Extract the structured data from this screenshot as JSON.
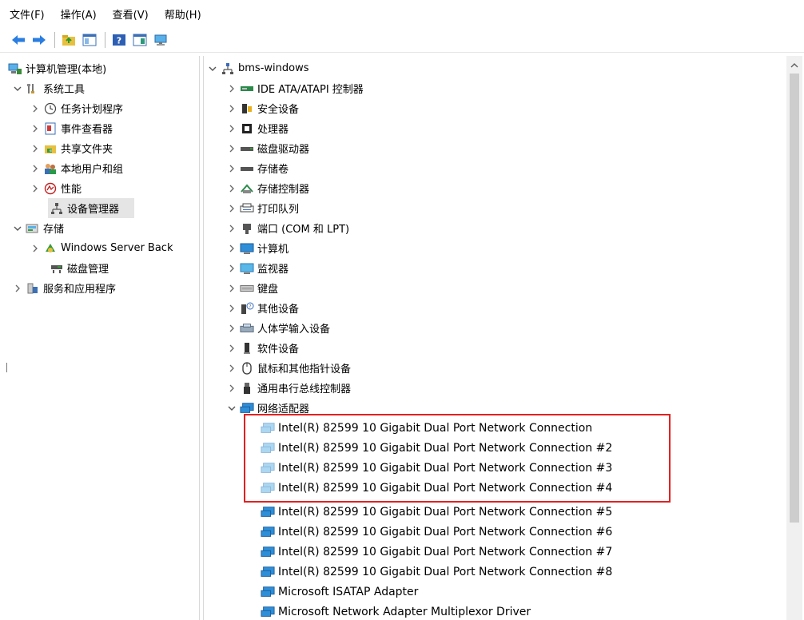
{
  "menu": {
    "file": "文件(F)",
    "action": "操作(A)",
    "view": "查看(V)",
    "help": "帮助(H)"
  },
  "left_tree": {
    "root": "计算机管理(本地)",
    "system_tools": "系统工具",
    "task_scheduler": "任务计划程序",
    "event_viewer": "事件查看器",
    "shared_folders": "共享文件夹",
    "local_users": "本地用户和组",
    "performance": "性能",
    "device_manager": "设备管理器",
    "storage": "存储",
    "windows_server_backup": "Windows Server Back",
    "disk_management": "磁盘管理",
    "services_apps": "服务和应用程序"
  },
  "device_tree": {
    "computer_name": "bms-windows",
    "categories": [
      "IDE ATA/ATAPI 控制器",
      "安全设备",
      "处理器",
      "磁盘驱动器",
      "存储卷",
      "存储控制器",
      "打印队列",
      "端口 (COM 和 LPT)",
      "计算机",
      "监视器",
      "键盘",
      "其他设备",
      "人体学输入设备",
      "软件设备",
      "鼠标和其他指针设备",
      "通用串行总线控制器",
      "网络适配器"
    ],
    "network_adapters": [
      "Intel(R) 82599 10 Gigabit Dual Port Network Connection",
      "Intel(R) 82599 10 Gigabit Dual Port Network Connection #2",
      "Intel(R) 82599 10 Gigabit Dual Port Network Connection #3",
      "Intel(R) 82599 10 Gigabit Dual Port Network Connection #4",
      "Intel(R) 82599 10 Gigabit Dual Port Network Connection #5",
      "Intel(R) 82599 10 Gigabit Dual Port Network Connection #6",
      "Intel(R) 82599 10 Gigabit Dual Port Network Connection #7",
      "Intel(R) 82599 10 Gigabit Dual Port Network Connection #8",
      "Microsoft ISATAP Adapter",
      "Microsoft Network Adapter Multiplexor Driver"
    ]
  },
  "colors": {
    "highlight_border": "#e32020",
    "selection_bg": "#e5e5e5",
    "net_icon_blue": "#2e8fd8"
  }
}
